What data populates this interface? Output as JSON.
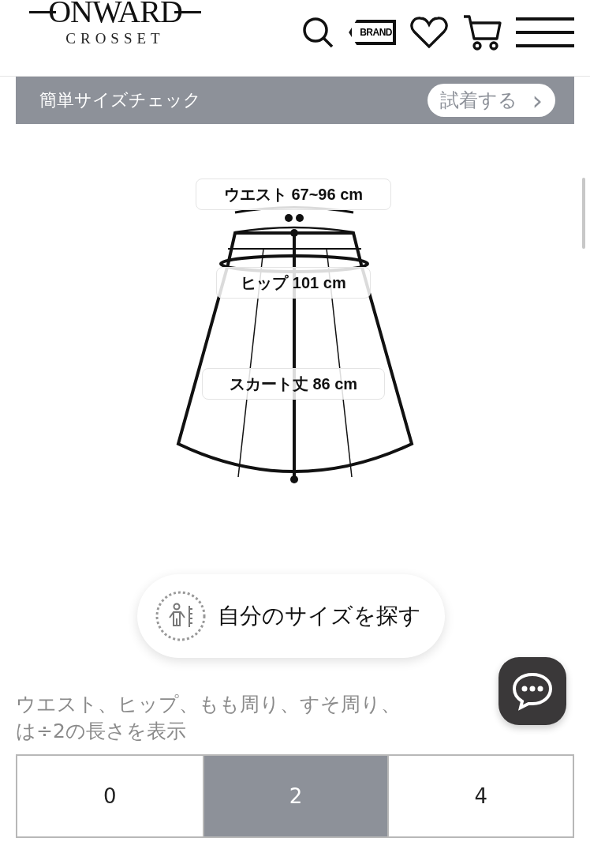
{
  "header": {
    "logo": {
      "brand": "ONWARD",
      "sub": "CROSSET"
    },
    "brand_badge": "BRAND"
  },
  "size_check": {
    "title": "簡単サイズチェック",
    "button": "試着する",
    "chevron": "›"
  },
  "diagram": {
    "kind": "skirt",
    "labels": [
      {
        "kind": "waist",
        "text": "ウエスト 67~96 cm"
      },
      {
        "kind": "hip",
        "text": "ヒップ 101 cm"
      },
      {
        "kind": "length",
        "text": "スカート丈 86 cm"
      }
    ]
  },
  "find_size_button": "自分のサイズを探す",
  "note": {
    "lines": [
      "ウエスト、ヒップ、もも周り、すそ周り、",
      "は÷2の長さを表示"
    ]
  },
  "sizes": [
    {
      "label": "0",
      "selected": false
    },
    {
      "label": "2",
      "selected": true
    },
    {
      "label": "4",
      "selected": false
    }
  ]
}
